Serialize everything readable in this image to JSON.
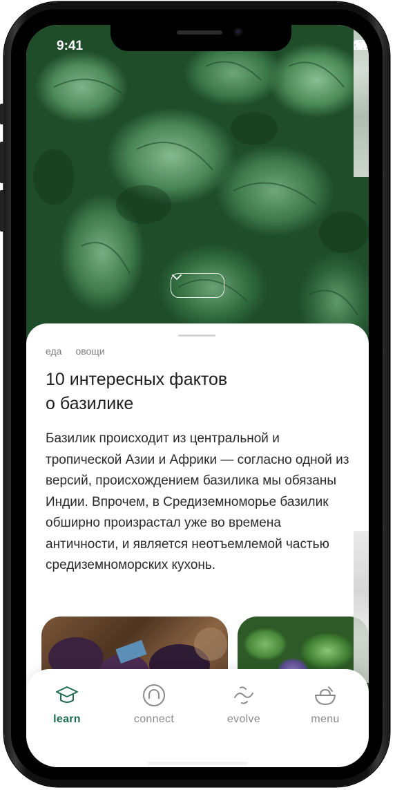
{
  "status": {
    "time": "9:41"
  },
  "article": {
    "tags": [
      "еда",
      "овощи"
    ],
    "title_line1": "10 интересных фактов",
    "title_line2": "о базилике",
    "body": "Базилик происходит из центральной и тропической Азии и Африки — согласно одной из версий, происхождением базилика мы обязаны Индии. Впрочем, в Средиземноморье базилик обширно произрастал уже во времена античности, и является неотъемлемой частью средиземноморских кухонь."
  },
  "tabs": [
    {
      "label": "learn",
      "icon": "graduation-cap-icon",
      "active": true
    },
    {
      "label": "connect",
      "icon": "connect-circle-icon",
      "active": false
    },
    {
      "label": "evolve",
      "icon": "evolve-wave-icon",
      "active": false
    },
    {
      "label": "menu",
      "icon": "bowl-icon",
      "active": false
    }
  ],
  "colors": {
    "accent": "#1f6b4e",
    "inactive": "#8a8a8a"
  }
}
